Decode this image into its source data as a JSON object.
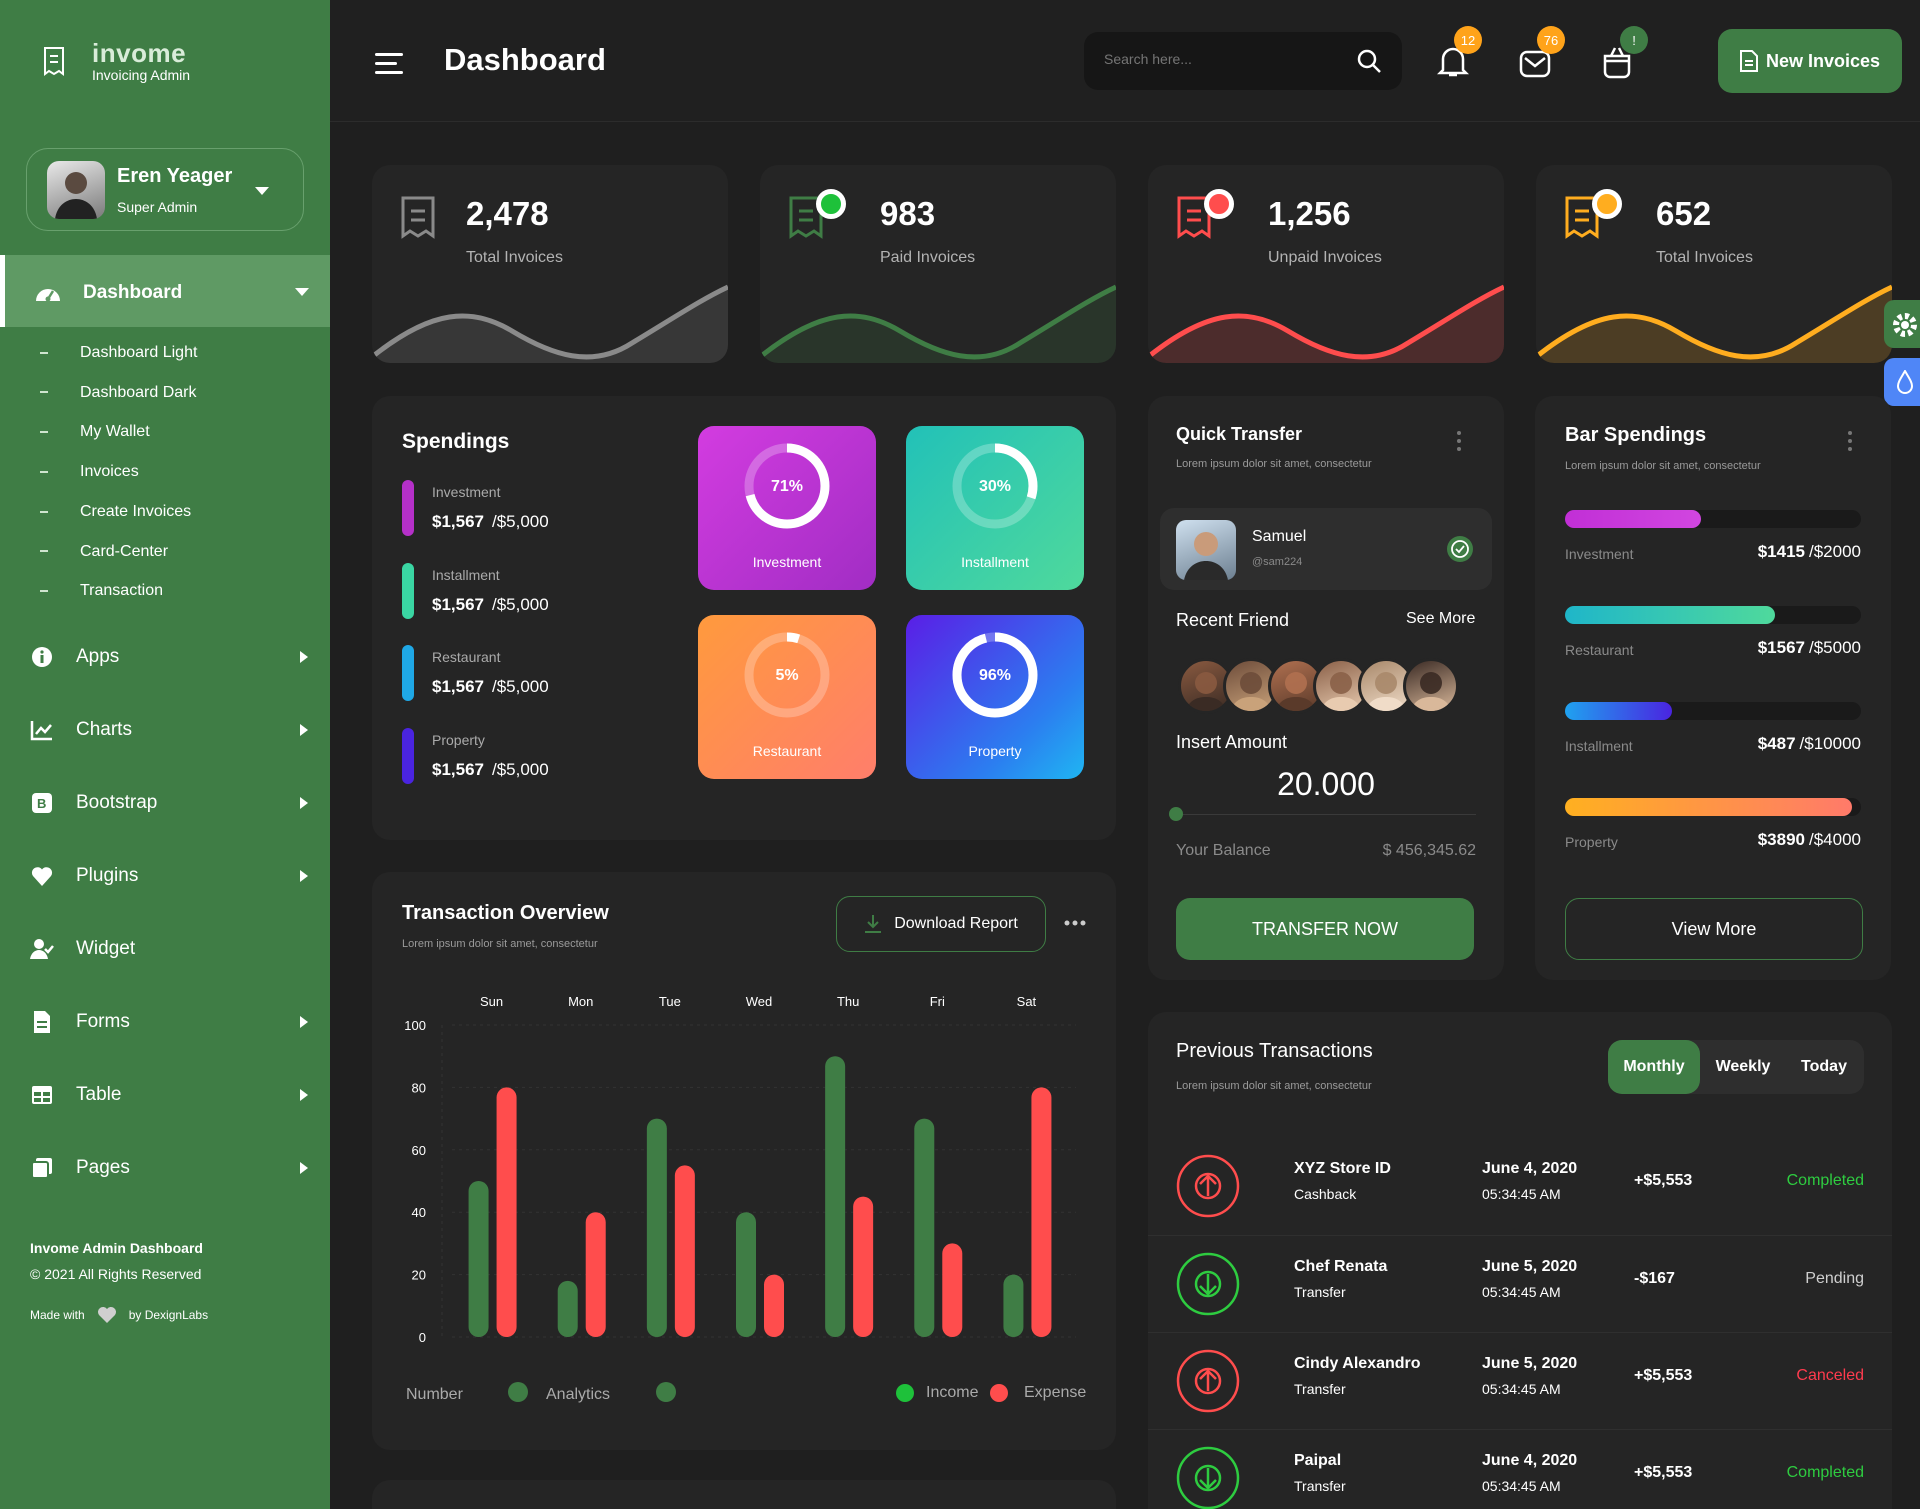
{
  "brand": {
    "name": "invome",
    "subtitle": "Invoicing Admin"
  },
  "user": {
    "name": "Eren Yeager",
    "role": "Super Admin"
  },
  "sidebar": {
    "active": "Dashboard",
    "submenu": [
      "Dashboard Light",
      "Dashboard Dark",
      "My Wallet",
      "Invoices",
      "Create Invoices",
      "Card-Center",
      "Transaction"
    ],
    "items": [
      {
        "label": "Apps",
        "icon": "info-icon"
      },
      {
        "label": "Charts",
        "icon": "chart-icon"
      },
      {
        "label": "Bootstrap",
        "icon": "bootstrap-icon"
      },
      {
        "label": "Plugins",
        "icon": "heart-icon"
      },
      {
        "label": "Widget",
        "icon": "user-check-icon"
      },
      {
        "label": "Forms",
        "icon": "document-icon"
      },
      {
        "label": "Table",
        "icon": "table-icon"
      },
      {
        "label": "Pages",
        "icon": "pages-icon"
      }
    ],
    "footer": {
      "title": "Invome Admin Dashboard",
      "copyright": "© 2021 All Rights Reserved",
      "made_with": "Made with",
      "by": "by DexignLabs"
    }
  },
  "header": {
    "title": "Dashboard",
    "search_placeholder": "Search here...",
    "notifications_badge": "12",
    "messages_badge": "76",
    "cart_badge": "!",
    "new_invoices_label": "New Invoices"
  },
  "stats": [
    {
      "value": "2,478",
      "label": "Total Invoices",
      "color": "#8a8a8a"
    },
    {
      "value": "983",
      "label": "Paid Invoices",
      "color": "#3f7d45",
      "dot": "#1ec13a"
    },
    {
      "value": "1,256",
      "label": "Unpaid Invoices",
      "color": "#ff4d4d",
      "dot": "#ff4d4d"
    },
    {
      "value": "652",
      "label": "Total Invoices",
      "color": "#ffad1f",
      "dot": "#ffad1f"
    }
  ],
  "spendings": {
    "title": "Spendings",
    "items": [
      {
        "name": "Investment",
        "amount": "$1,567",
        "total": "/$5,000",
        "color": "#b530c9"
      },
      {
        "name": "Installment",
        "amount": "$1,567",
        "total": "/$5,000",
        "color": "#3ad6a3"
      },
      {
        "name": "Restaurant",
        "amount": "$1,567",
        "total": "/$5,000",
        "color": "#1fa8e6"
      },
      {
        "name": "Property",
        "amount": "$1,567",
        "total": "/$5,000",
        "color": "#4a24e0"
      }
    ],
    "tiles": [
      {
        "label": "Investment",
        "percent": "71%",
        "value": 71
      },
      {
        "label": "Installment",
        "percent": "30%",
        "value": 30
      },
      {
        "label": "Restaurant",
        "percent": "5%",
        "value": 5
      },
      {
        "label": "Property",
        "percent": "96%",
        "value": 96
      }
    ]
  },
  "quick_transfer": {
    "title": "Quick Transfer",
    "subtitle": "Lorem ipsum dolor sit amet, consectetur",
    "contact_name": "Samuel",
    "contact_handle": "@sam224",
    "recent_friend": "Recent Friend",
    "see_more": "See More",
    "insert_amount": "Insert Amount",
    "amount": "20.000",
    "balance_label": "Your Balance",
    "balance_value": "$ 456,345.62",
    "button": "TRANSFER NOW"
  },
  "bar_spendings": {
    "title": "Bar Spendings",
    "subtitle": "Lorem ipsum dolor sit amet, consectetur",
    "items": [
      {
        "name": "Investment",
        "value": "$1415",
        "total": "/$2000",
        "fraction": 0.46
      },
      {
        "name": "Restaurant",
        "value": "$1567",
        "total": "/$5000",
        "fraction": 0.71
      },
      {
        "name": "Installment",
        "value": "$487",
        "total": "/$10000",
        "fraction": 0.36
      },
      {
        "name": "Property",
        "value": "$3890",
        "total": "/$4000",
        "fraction": 0.97
      }
    ],
    "button": "View More"
  },
  "transaction_overview": {
    "title": "Transaction Overview",
    "subtitle": "Lorem ipsum dolor sit amet, consectetur",
    "download": "Download Report",
    "legend_left": [
      "Number",
      "Analytics"
    ],
    "legend_right": [
      "Income",
      "Expense"
    ]
  },
  "chart_data": {
    "type": "bar",
    "categories": [
      "Sun",
      "Mon",
      "Tue",
      "Wed",
      "Thu",
      "Fri",
      "Sat"
    ],
    "series": [
      {
        "name": "Income",
        "color": "#3f7d45",
        "values": [
          50,
          18,
          70,
          40,
          90,
          70,
          20
        ]
      },
      {
        "name": "Expense",
        "color": "#ff4d4d",
        "values": [
          80,
          40,
          55,
          20,
          45,
          30,
          80
        ]
      }
    ],
    "yticks": [
      "0",
      "20",
      "40",
      "60",
      "80",
      "100"
    ],
    "ylim": [
      0,
      100
    ],
    "grid": true
  },
  "previous_transactions": {
    "title": "Previous Transactions",
    "subtitle": "Lorem ipsum dolor sit amet, consectetur",
    "tabs": [
      "Monthly",
      "Weekly",
      "Today"
    ],
    "active_tab": "Monthly",
    "rows": [
      {
        "name": "XYZ Store ID",
        "type": "Cashback",
        "date": "June 4, 2020",
        "time": "05:34:45 AM",
        "amount": "+$5,553",
        "status": "Completed",
        "status_color": "#2ecc40",
        "dir": "up"
      },
      {
        "name": "Chef Renata",
        "type": "Transfer",
        "date": "June 5, 2020",
        "time": "05:34:45 AM",
        "amount": "-$167",
        "status": "Pending",
        "status_color": "#cfcfcf",
        "dir": "down"
      },
      {
        "name": "Cindy Alexandro",
        "type": "Transfer",
        "date": "June 5, 2020",
        "time": "05:34:45 AM",
        "amount": "+$5,553",
        "status": "Canceled",
        "status_color": "#ff3b4e",
        "dir": "up"
      },
      {
        "name": "Paipal",
        "type": "Transfer",
        "date": "June 4, 2020",
        "time": "05:34:45 AM",
        "amount": "+$5,553",
        "status": "Completed",
        "status_color": "#2ecc40",
        "dir": "down"
      }
    ]
  }
}
